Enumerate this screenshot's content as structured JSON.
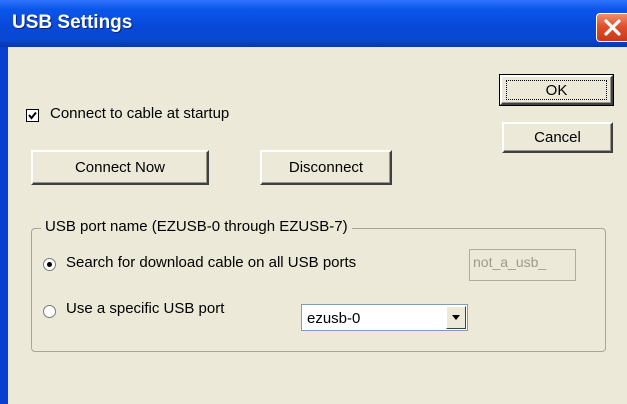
{
  "window": {
    "title": "USB Settings"
  },
  "startup": {
    "checkbox_label": "Connect to cable at startup",
    "checked": true
  },
  "buttons": {
    "ok": "OK",
    "cancel": "Cancel",
    "connect_now": "Connect Now",
    "disconnect": "Disconnect"
  },
  "usb_port_group": {
    "title": "USB port name (EZUSB-0 through EZUSB-7)",
    "search_all_label": "Search for download cable on all USB ports",
    "search_all_selected": true,
    "search_value": "not_a_usb_",
    "specific_label": "Use a specific USB port",
    "specific_selected": false,
    "port_select_value": "ezusb-0"
  },
  "icons": {
    "close": "close-icon",
    "dropdown": "chevron-down-icon",
    "check": "checkmark-icon"
  },
  "colors": {
    "title_bar": "#0a47d0",
    "dialog_bg": "#ece9d8",
    "close_button": "#e0502d"
  }
}
